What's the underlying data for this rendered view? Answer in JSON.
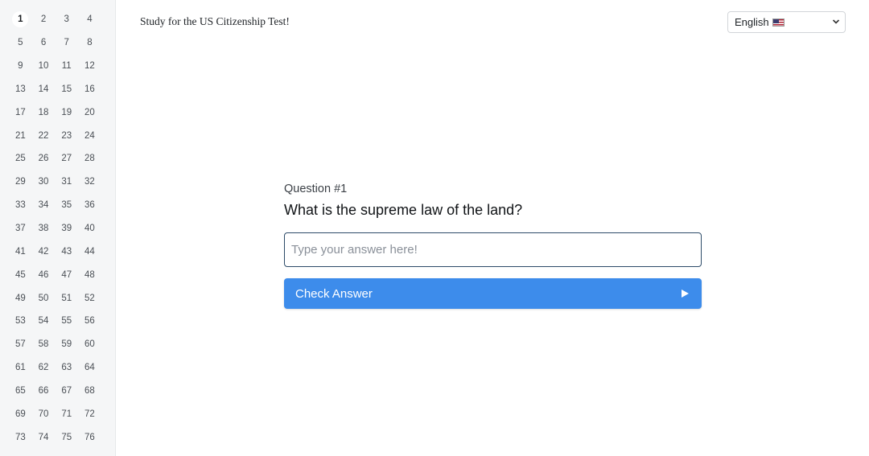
{
  "header": {
    "title": "Study for the US Citizenship Test!"
  },
  "language_select": {
    "selected": "English",
    "flag_icon": "us-flag-icon"
  },
  "sidebar": {
    "numbers": [
      "1",
      "2",
      "3",
      "4",
      "5",
      "6",
      "7",
      "8",
      "9",
      "10",
      "11",
      "12",
      "13",
      "14",
      "15",
      "16",
      "17",
      "18",
      "19",
      "20",
      "21",
      "22",
      "23",
      "24",
      "25",
      "26",
      "27",
      "28",
      "29",
      "30",
      "31",
      "32",
      "33",
      "34",
      "35",
      "36",
      "37",
      "38",
      "39",
      "40",
      "41",
      "42",
      "43",
      "44",
      "45",
      "46",
      "47",
      "48",
      "49",
      "50",
      "51",
      "52",
      "53",
      "54",
      "55",
      "56",
      "57",
      "58",
      "59",
      "60",
      "61",
      "62",
      "63",
      "64",
      "65",
      "66",
      "67",
      "68",
      "69",
      "70",
      "71",
      "72",
      "73",
      "74",
      "75",
      "76"
    ],
    "active": "1"
  },
  "question": {
    "number_label": "Question #1",
    "text": "What is the supreme law of the land?"
  },
  "answer": {
    "value": "",
    "placeholder": "Type your answer here!"
  },
  "check_button": {
    "label": "Check Answer",
    "icon": "play-icon"
  },
  "colors": {
    "button_bg": "#3d8ceb",
    "input_border": "#2c4a68",
    "sidebar_bg": "#f5f6f7"
  }
}
